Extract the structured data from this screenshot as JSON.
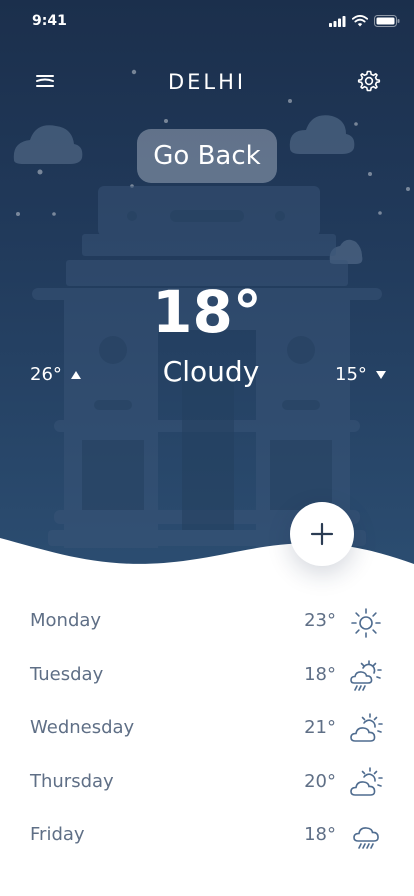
{
  "status_bar": {
    "time": "9:41"
  },
  "header": {
    "city": "DELHI",
    "go_back_label": "Go Back"
  },
  "current": {
    "temperature": "18°",
    "condition": "Cloudy",
    "high": "26°",
    "low": "15°"
  },
  "forecast": [
    {
      "day": "Monday",
      "temp": "23°",
      "icon": "sun-icon"
    },
    {
      "day": "Tuesday",
      "temp": "18°",
      "icon": "sun-rain-icon"
    },
    {
      "day": "Wednesday",
      "temp": "21°",
      "icon": "partly-cloudy-icon"
    },
    {
      "day": "Thursday",
      "temp": "20°",
      "icon": "partly-cloudy-icon"
    },
    {
      "day": "Friday",
      "temp": "18°",
      "icon": "rain-cloud-icon"
    }
  ],
  "colors": {
    "hero_top": "#1b2f4c",
    "hero_bottom": "#2c4e72",
    "text_muted": "#5f6f86",
    "icon_stroke": "#4f6c8f"
  }
}
